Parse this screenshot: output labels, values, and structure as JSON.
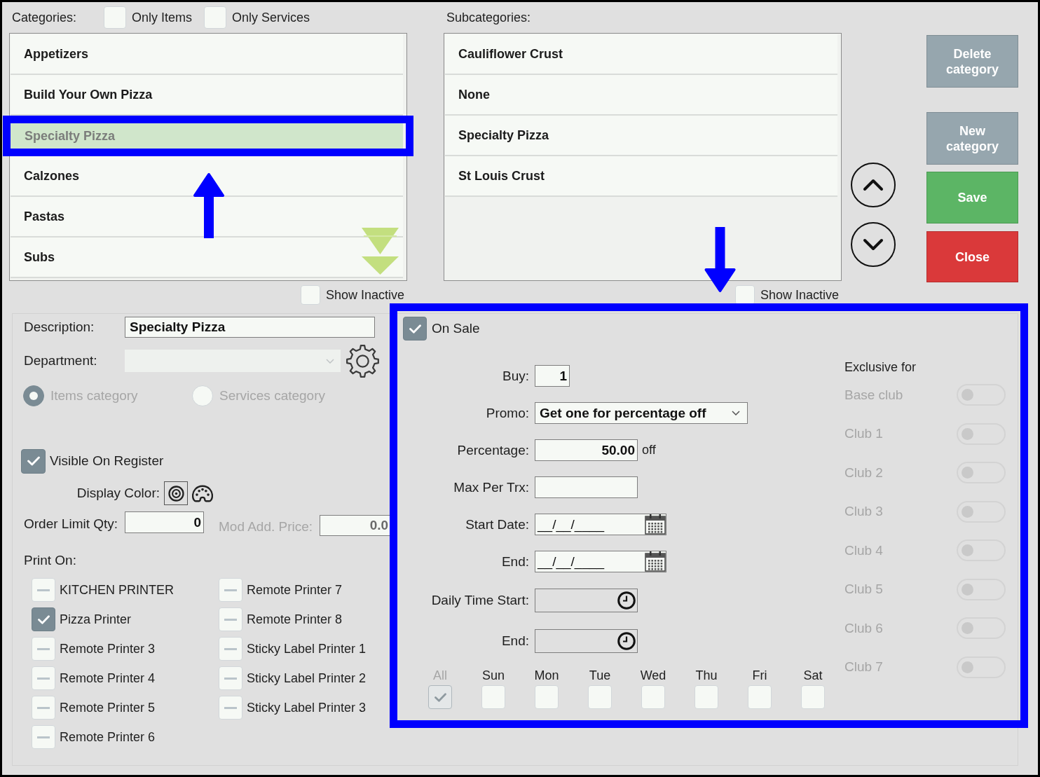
{
  "categories": {
    "label": "Categories:",
    "filters": [
      {
        "label": "Only Items",
        "checked": false
      },
      {
        "label": "Only Services",
        "checked": false
      }
    ],
    "items": [
      {
        "label": "Appetizers",
        "selected": false
      },
      {
        "label": "Build Your Own Pizza",
        "selected": false
      },
      {
        "label": "Specialty Pizza",
        "selected": true
      },
      {
        "label": "Calzones",
        "selected": false
      },
      {
        "label": "Pastas",
        "selected": false
      },
      {
        "label": "Subs",
        "selected": false
      }
    ],
    "show_inactive": {
      "label": "Show Inactive",
      "checked": false
    }
  },
  "subcategories": {
    "label": "Subcategories:",
    "items": [
      {
        "label": "Cauliflower Crust",
        "selected": false
      },
      {
        "label": "None",
        "selected": false
      },
      {
        "label": "Specialty Pizza",
        "selected": false
      },
      {
        "label": "St Louis Crust",
        "selected": false
      }
    ],
    "show_inactive": {
      "label": "Show Inactive",
      "checked": false
    }
  },
  "actions": [
    {
      "label": "Delete category",
      "kind": "secondary"
    },
    {
      "label": "New category",
      "kind": "secondary"
    },
    {
      "label": "Save",
      "kind": "save"
    },
    {
      "label": "Close",
      "kind": "close"
    }
  ],
  "details": {
    "description": {
      "label": "Description:",
      "value": "Specialty Pizza"
    },
    "department": {
      "label": "Department:",
      "disabled": true
    },
    "category_type": [
      {
        "label": "Items category",
        "selected": true,
        "disabled": true
      },
      {
        "label": "Services category",
        "selected": false,
        "disabled": true
      }
    ],
    "visible_on_register": {
      "label": "Visible On Register",
      "checked": true
    },
    "display_color": {
      "label": "Display Color:"
    },
    "order_limit_qty": {
      "label": "Order Limit Qty:",
      "value": "0"
    },
    "mod_add_price": {
      "label": "Mod Add. Price:",
      "value": "0.0",
      "disabled": true
    },
    "print_on": {
      "label": "Print On:",
      "printers": [
        {
          "label": "KITCHEN PRINTER",
          "checked": false
        },
        {
          "label": "Pizza Printer",
          "checked": true
        },
        {
          "label": "Remote Printer 3",
          "checked": false
        },
        {
          "label": "Remote Printer 4",
          "checked": false
        },
        {
          "label": "Remote Printer 5",
          "checked": false
        },
        {
          "label": "Remote Printer 6",
          "checked": false
        },
        {
          "label": "Remote Printer 7",
          "checked": false
        },
        {
          "label": "Remote Printer 8",
          "checked": false
        },
        {
          "label": "Sticky Label Printer 1",
          "checked": false
        },
        {
          "label": "Sticky Label Printer 2",
          "checked": false
        },
        {
          "label": "Sticky Label Printer 3",
          "checked": false
        }
      ]
    }
  },
  "sale": {
    "on_sale": {
      "label": "On Sale",
      "checked": true
    },
    "fields": [
      {
        "kind": "number",
        "label": "Buy:",
        "value": "1"
      },
      {
        "kind": "select",
        "label": "Promo:",
        "value": "Get one for percentage off"
      },
      {
        "kind": "number",
        "label": "Percentage:",
        "value": "50.00",
        "suffix": "off"
      },
      {
        "kind": "number",
        "label": "Max Per Trx:"
      },
      {
        "kind": "date",
        "label": "Start Date:",
        "value": "__/__/____"
      },
      {
        "kind": "date",
        "label": "End:",
        "value": "__/__/____"
      },
      {
        "kind": "time",
        "label": "Daily Time Start:"
      },
      {
        "kind": "time",
        "label": "End:"
      }
    ],
    "days": [
      {
        "label": "All",
        "checked": true,
        "disabled": true
      },
      {
        "label": "Sun",
        "checked": false,
        "disabled": false
      },
      {
        "label": "Mon",
        "checked": false,
        "disabled": false
      },
      {
        "label": "Tue",
        "checked": false,
        "disabled": false
      },
      {
        "label": "Wed",
        "checked": false,
        "disabled": false
      },
      {
        "label": "Thu",
        "checked": false,
        "disabled": false
      },
      {
        "label": "Fri",
        "checked": false,
        "disabled": false
      },
      {
        "label": "Sat",
        "checked": false,
        "disabled": false
      }
    ],
    "exclusive": {
      "label": "Exclusive for",
      "clubs": [
        {
          "label": "Base club",
          "on": false,
          "disabled": true
        },
        {
          "label": "Club 1",
          "on": false,
          "disabled": true
        },
        {
          "label": "Club 2",
          "on": false,
          "disabled": true
        },
        {
          "label": "Club 3",
          "on": false,
          "disabled": true
        },
        {
          "label": "Club 4",
          "on": false,
          "disabled": true
        },
        {
          "label": "Club 5",
          "on": false,
          "disabled": true
        },
        {
          "label": "Club 6",
          "on": false,
          "disabled": true
        },
        {
          "label": "Club 7",
          "on": false,
          "disabled": true
        }
      ]
    }
  },
  "annotations": [
    {
      "kind": "frame"
    },
    {
      "kind": "arrow-up"
    },
    {
      "kind": "arrow-down"
    },
    {
      "kind": "frame"
    }
  ]
}
